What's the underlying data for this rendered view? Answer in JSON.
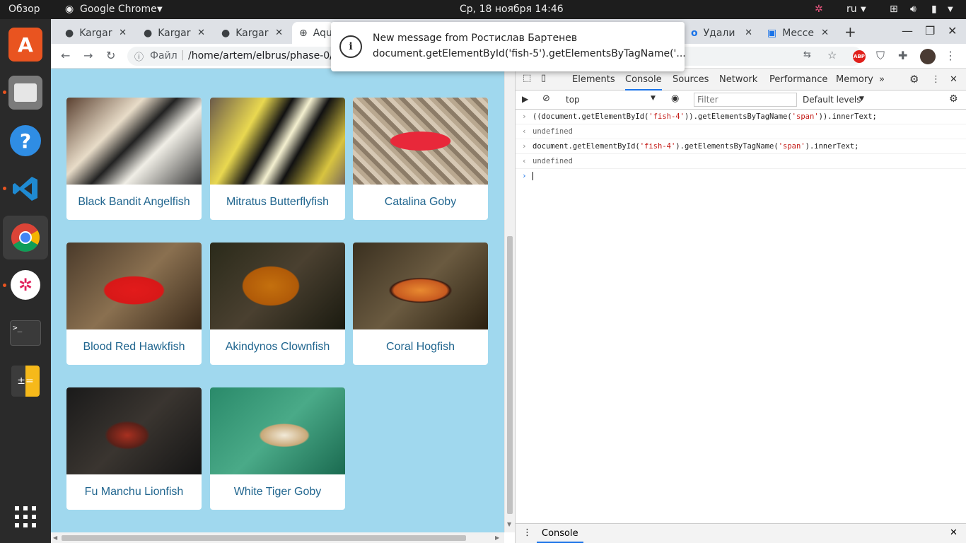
{
  "topbar": {
    "overview": "Обзор",
    "app_name": "Google Chrome",
    "datetime": "Ср, 18 ноября  14:46",
    "lang": "ru"
  },
  "tabs": [
    {
      "label": "Kargar",
      "icon": "github-icon"
    },
    {
      "label": "Kargar",
      "icon": "github-icon"
    },
    {
      "label": "Kargar",
      "icon": "github-icon"
    },
    {
      "label": "Aqu",
      "icon": "globe-icon"
    },
    {
      "label": "Удали",
      "icon": "o-icon"
    },
    {
      "label": "Мессе",
      "icon": "messenger-icon"
    }
  ],
  "address": {
    "file_label": "Файл",
    "url": "/home/artem/elbrus/phase-0/con"
  },
  "notification": {
    "title": "New message from Ростислав Бартенев",
    "body": "document.getElementById('fish-5').getElementsByTagName('..."
  },
  "fish": [
    {
      "name": "Black Bandit Angelfish"
    },
    {
      "name": "Mitratus Butterflyfish"
    },
    {
      "name": "Catalina Goby"
    },
    {
      "name": "Blood Red Hawkfish"
    },
    {
      "name": "Akindynos Clownfish"
    },
    {
      "name": "Coral Hogfish"
    },
    {
      "name": "Fu Manchu Lionfish"
    },
    {
      "name": "White Tiger Goby"
    }
  ],
  "devtools": {
    "tabs": [
      "Elements",
      "Console",
      "Sources",
      "Network",
      "Performance",
      "Memory"
    ],
    "active_tab": "Console",
    "context": "top",
    "filter_placeholder": "Filter",
    "levels": "Default levels",
    "console": [
      {
        "kind": "input",
        "pre": "((document.getElementById(",
        "s1": "'fish-4'",
        "mid": ")).getElementsByTagName(",
        "s2": "'span'",
        "post": ")).innerText;"
      },
      {
        "kind": "output",
        "text": "undefined"
      },
      {
        "kind": "input",
        "pre": "document.getElementById(",
        "s1": "'fish-4'",
        "mid": ").getElementsByTagName(",
        "s2": "'span'",
        "post": ").innerText;"
      },
      {
        "kind": "output",
        "text": "undefined"
      }
    ],
    "drawer_tab": "Console"
  },
  "colors": {
    "page_bg": "#a0d8ee",
    "fish_name": "#21668f",
    "ubuntu_orange": "#e95420"
  }
}
